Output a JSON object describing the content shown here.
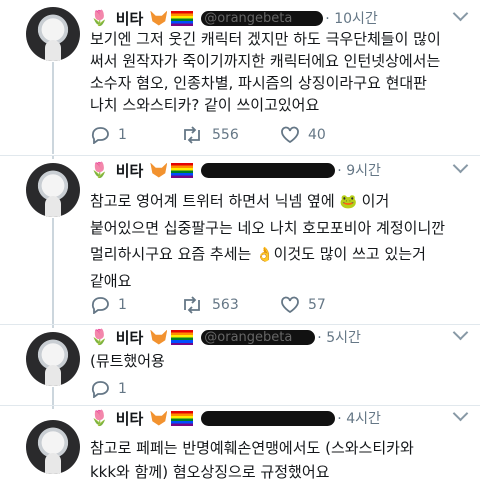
{
  "tweets": [
    {
      "display_name": "비타",
      "emoji_1": "🌷",
      "redacted_handle": "@orangebeta",
      "time": "· 10시간",
      "lines": [
        "보기엔 그저 웃긴 캐릭터 겠지만 하도 극우단체들이 많이",
        "써서 원작자가 죽이기까지한 캐릭터에요 인턴넷상에서는",
        "소수자 혐오, 인종차별, 파시즘의 상징이라구요 현대판",
        "나치 스와스티카? 같이 쓰이고있어요"
      ],
      "reply": "1",
      "retweet": "556",
      "like": "40"
    },
    {
      "display_name": "비타",
      "emoji_1": "🌷",
      "redacted_handle": "",
      "time": "· 9시간",
      "line1_pre": "참고로 영어계 트위터 하면서 닉넴 옆에",
      "line1_emoji": "🐸",
      "line1_post": "이거",
      "line2": "붙어있으면 십중팔구는 네오 나치 호모포비아 계정이니깐",
      "line3_pre": "멀리하시구요 요즘 추세는",
      "line3_emoji": "👌",
      "line3_post": "이것도 많이 쓰고 있는거",
      "line4": "같애요",
      "reply": "1",
      "retweet": "563",
      "like": "57"
    },
    {
      "display_name": "비타",
      "emoji_1": "🌷",
      "redacted_handle": "@orangebeta",
      "time": "· 5시간",
      "lines": [
        "(뮤트했어용"
      ],
      "reply": "1"
    },
    {
      "display_name": "비타",
      "emoji_1": "🌷",
      "redacted_handle": "",
      "time": "· 4시간",
      "lines": [
        "참고로 페페는 반명예훼손연맹에서도 (스와스티카와",
        "kkk와 함께) 혐오상징으로 규정했어요"
      ]
    }
  ]
}
